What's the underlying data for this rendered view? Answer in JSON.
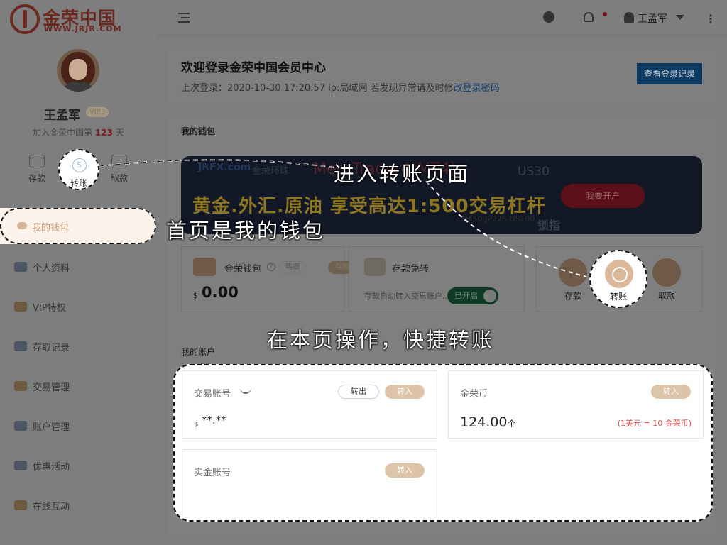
{
  "brand": {
    "name": "金荣中国",
    "url": "WWW.JRJR.COM"
  },
  "topbar": {
    "username": "王孟军"
  },
  "profile": {
    "name": "王孟军",
    "vip": "VIP3",
    "join_prefix": "加入金荣中国第",
    "join_days": "123",
    "join_suffix": "天"
  },
  "quick": [
    {
      "label": "存款",
      "icon": "deposit-icon"
    },
    {
      "label": "转账",
      "icon": "transfer-icon"
    },
    {
      "label": "取款",
      "icon": "withdraw-icon"
    }
  ],
  "nav": [
    {
      "label": "我的钱包",
      "icon": "wallet-icon"
    },
    {
      "label": "个人资料",
      "icon": "profile-icon"
    },
    {
      "label": "VIP特权",
      "icon": "vip-icon"
    },
    {
      "label": "存取记录",
      "icon": "records-icon"
    },
    {
      "label": "交易管理",
      "icon": "trade-icon"
    },
    {
      "label": "账户管理",
      "icon": "account-icon"
    },
    {
      "label": "优惠活动",
      "icon": "promo-icon"
    },
    {
      "label": "在线互动",
      "icon": "chat-icon"
    }
  ],
  "welcome": {
    "title": "欢迎登录金荣中国会员中心",
    "last_login": "上次登录：2020-10-30 17:20:57 ip:局域网 若发现异常请及时修",
    "change_pwd": "改登录密码",
    "records_button": "查看登录记录"
  },
  "wallet": {
    "heading": "我的钱包",
    "banner": {
      "logo": "JRFX.com",
      "logo2": "金荣环球",
      "mt": "MetaTrader4(MT4)",
      "us": "US30",
      "headline": "黄金.外汇.原油  享受高达1:500交易杠杆",
      "button": "我要开户",
      "sub": "HK50  JP225  US100",
      "lock": "锁指"
    },
    "balance": {
      "name": "金荣钱包",
      "q": "?",
      "detail": "明细",
      "deposit": "存款",
      "currency": "$",
      "amount": "0.00"
    },
    "auto": {
      "name": "存款免转",
      "desc": "存款自动转入交易账户...",
      "toggle": "已开启"
    },
    "actions": [
      {
        "label": "存款"
      },
      {
        "label": "转账"
      },
      {
        "label": "取款"
      }
    ]
  },
  "accounts": {
    "heading": "我的账户",
    "trading": {
      "title": "交易账号",
      "out": "转出",
      "in": "转入",
      "currency": "$",
      "value": "**.**"
    },
    "coin": {
      "title": "金荣币",
      "in": "转入",
      "value": "124.00",
      "unit": "个",
      "rate": "(1美元 = 10 金荣币)"
    },
    "real": {
      "title": "实金账号",
      "in": "转入"
    }
  },
  "captions": {
    "transfer": "进入转账页面",
    "home": "首页是我的钱包",
    "quick": "在本页操作，快捷转账"
  }
}
